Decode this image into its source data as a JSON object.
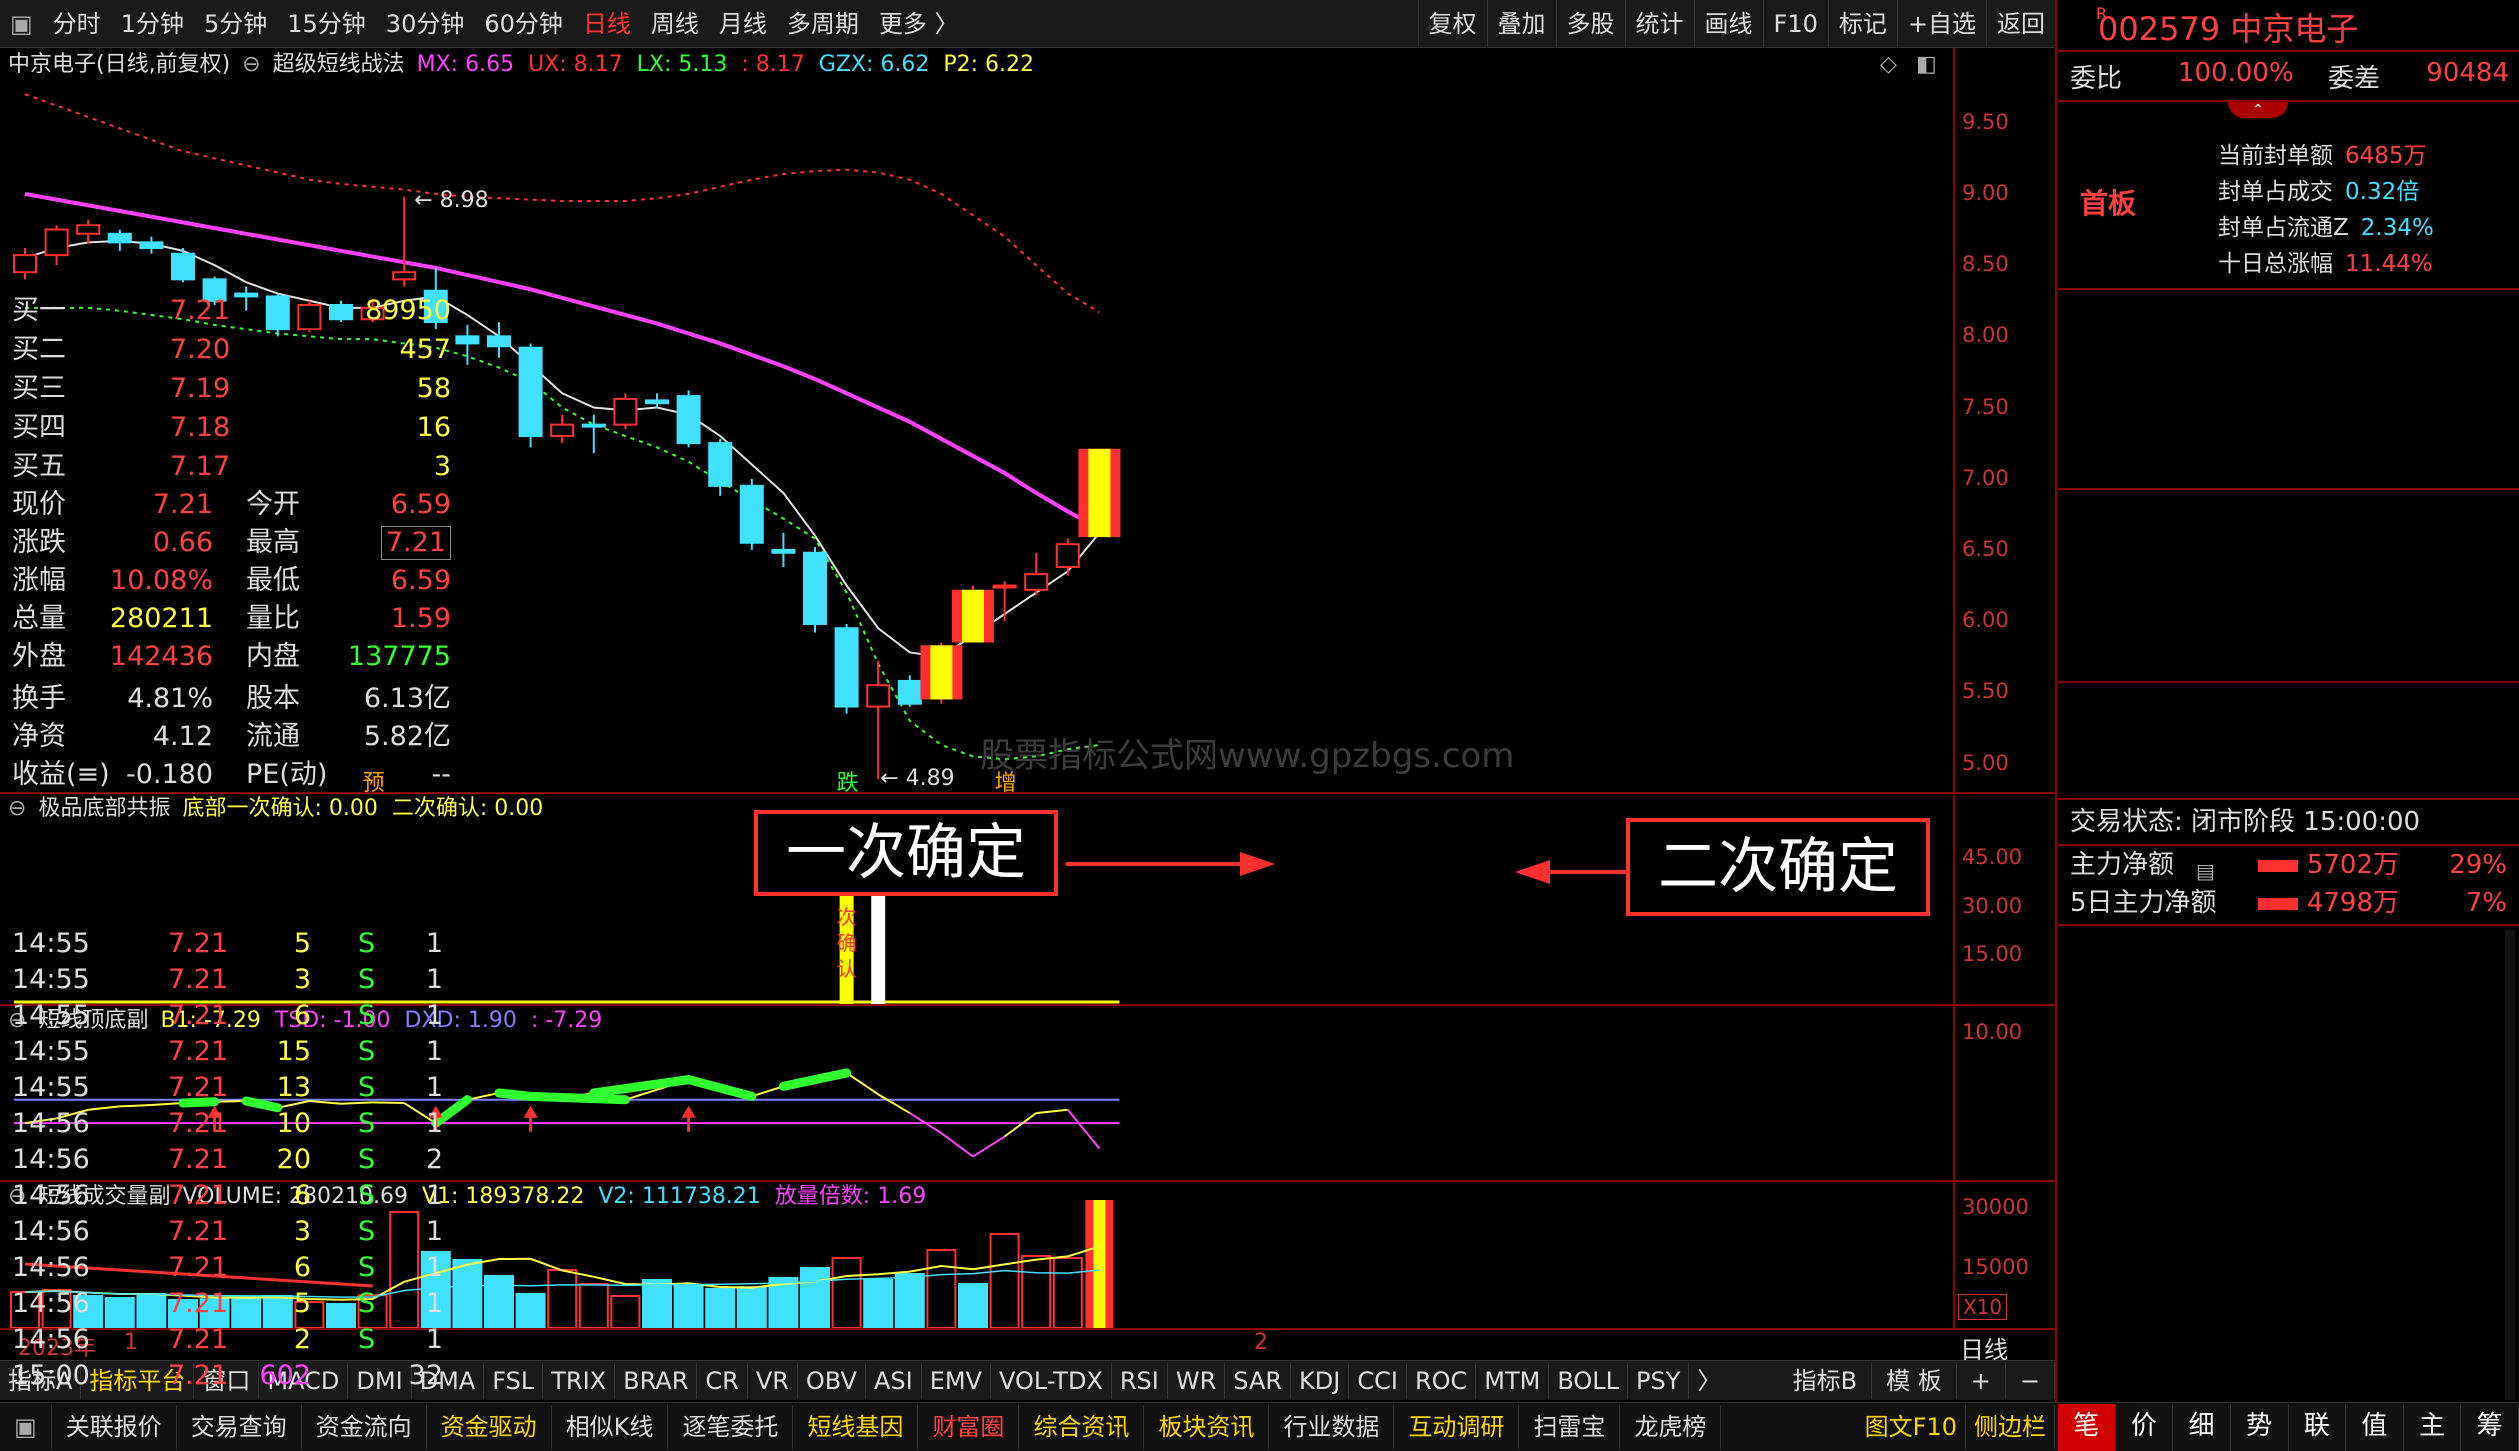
{
  "toolbar": {
    "periods": [
      "分时",
      "1分钟",
      "5分钟",
      "15分钟",
      "30分钟",
      "60分钟",
      "日线",
      "周线",
      "月线",
      "多周期",
      "更多 〉"
    ],
    "active_period": "日线",
    "right_buttons": [
      "复权",
      "叠加",
      "多股",
      "统计",
      "画线",
      "F10",
      "标记",
      "+自选",
      "返回"
    ]
  },
  "main_chart": {
    "title": "中京电子(日线,前复权)",
    "indicator": "超级短线战法",
    "params": [
      {
        "text": "MX: 6.65",
        "color": "#ff40ff"
      },
      {
        "text": "UX: 8.17",
        "color": "#ff3030"
      },
      {
        "text": "LX: 5.13",
        "color": "#30ff30"
      },
      {
        "text": ": 8.17",
        "color": "#ff3030"
      },
      {
        "text": "GZX: 6.62",
        "color": "#40e0ff"
      },
      {
        "text": "P2: 6.22",
        "color": "#ffff40"
      }
    ],
    "y_labels": [
      "9.50",
      "9.00",
      "8.50",
      "8.00",
      "7.50",
      "7.00",
      "6.50",
      "6.00",
      "5.50",
      "5.00"
    ],
    "high_marker": "8.98",
    "low_marker": "4.89",
    "tags": [
      {
        "text": "预",
        "color": "#ffa500"
      },
      {
        "text": "跌",
        "color": "#30ff30"
      },
      {
        "text": "增",
        "color": "#ffa500"
      }
    ],
    "watermark": "股票指标公式网www.gpzbgs.com"
  },
  "chart_data": [
    {
      "type": "candlestick",
      "title": "超级短线战法",
      "ylim": [
        4.8,
        9.8
      ],
      "candles": [
        {
          "o": 8.45,
          "h": 8.62,
          "l": 8.4,
          "c": 8.57
        },
        {
          "o": 8.57,
          "h": 8.78,
          "l": 8.5,
          "c": 8.75
        },
        {
          "o": 8.72,
          "h": 8.82,
          "l": 8.65,
          "c": 8.78
        },
        {
          "o": 8.72,
          "h": 8.75,
          "l": 8.6,
          "c": 8.66
        },
        {
          "o": 8.66,
          "h": 8.7,
          "l": 8.58,
          "c": 8.62
        },
        {
          "o": 8.58,
          "h": 8.62,
          "l": 8.38,
          "c": 8.4
        },
        {
          "o": 8.4,
          "h": 8.42,
          "l": 8.22,
          "c": 8.25
        },
        {
          "o": 8.3,
          "h": 8.35,
          "l": 8.18,
          "c": 8.28
        },
        {
          "o": 8.28,
          "h": 8.3,
          "l": 8.0,
          "c": 8.05
        },
        {
          "o": 8.05,
          "h": 8.25,
          "l": 8.03,
          "c": 8.22
        },
        {
          "o": 8.22,
          "h": 8.25,
          "l": 8.1,
          "c": 8.12
        },
        {
          "o": 8.12,
          "h": 8.25,
          "l": 8.1,
          "c": 8.2
        },
        {
          "o": 8.4,
          "h": 8.98,
          "l": 8.35,
          "c": 8.45
        },
        {
          "o": 8.32,
          "h": 8.48,
          "l": 8.05,
          "c": 8.1
        },
        {
          "o": 8.0,
          "h": 8.08,
          "l": 7.8,
          "c": 7.95
        },
        {
          "o": 8.0,
          "h": 8.1,
          "l": 7.85,
          "c": 7.93
        },
        {
          "o": 7.92,
          "h": 7.95,
          "l": 7.22,
          "c": 7.3
        },
        {
          "o": 7.3,
          "h": 7.45,
          "l": 7.25,
          "c": 7.38
        },
        {
          "o": 7.38,
          "h": 7.45,
          "l": 7.18,
          "c": 7.37
        },
        {
          "o": 7.38,
          "h": 7.6,
          "l": 7.35,
          "c": 7.56
        },
        {
          "o": 7.55,
          "h": 7.6,
          "l": 7.5,
          "c": 7.53
        },
        {
          "o": 7.58,
          "h": 7.62,
          "l": 7.22,
          "c": 7.25
        },
        {
          "o": 7.25,
          "h": 7.28,
          "l": 6.88,
          "c": 6.95
        },
        {
          "o": 6.95,
          "h": 7.0,
          "l": 6.5,
          "c": 6.55
        },
        {
          "o": 6.5,
          "h": 6.62,
          "l": 6.38,
          "c": 6.48
        },
        {
          "o": 6.48,
          "h": 6.52,
          "l": 5.92,
          "c": 5.98
        },
        {
          "o": 5.95,
          "h": 5.98,
          "l": 5.35,
          "c": 5.4
        },
        {
          "o": 5.4,
          "h": 5.72,
          "l": 4.89,
          "c": 5.55
        },
        {
          "o": 5.58,
          "h": 5.62,
          "l": 5.4,
          "c": 5.42
        },
        {
          "o": 5.45,
          "h": 5.85,
          "l": 5.42,
          "c": 5.83
        },
        {
          "o": 5.85,
          "h": 6.25,
          "l": 5.85,
          "c": 6.22
        },
        {
          "o": 6.25,
          "h": 6.28,
          "l": 6.0,
          "c": 6.25
        },
        {
          "o": 6.22,
          "h": 6.48,
          "l": 6.18,
          "c": 6.33
        },
        {
          "o": 6.38,
          "h": 6.58,
          "l": 6.32,
          "c": 6.54
        },
        {
          "o": 6.59,
          "h": 7.21,
          "l": 6.59,
          "c": 7.21
        }
      ],
      "series": [
        {
          "name": "MX",
          "color": "#ff40ff",
          "values": [
            9.0,
            8.96,
            8.92,
            8.88,
            8.84,
            8.8,
            8.76,
            8.72,
            8.68,
            8.64,
            8.6,
            8.56,
            8.52,
            8.48,
            8.43,
            8.38,
            8.33,
            8.27,
            8.21,
            8.15,
            8.09,
            8.02,
            7.95,
            7.87,
            7.79,
            7.7,
            7.6,
            7.5,
            7.4,
            7.28,
            7.16,
            7.04,
            6.9,
            6.77,
            6.65
          ]
        },
        {
          "name": "GZX",
          "color": "#e0e0e0",
          "values": [
            8.55,
            8.62,
            8.66,
            8.67,
            8.65,
            8.6,
            8.5,
            8.38,
            8.3,
            8.25,
            8.2,
            8.2,
            8.25,
            8.28,
            8.15,
            8.0,
            7.8,
            7.6,
            7.5,
            7.48,
            7.5,
            7.45,
            7.3,
            7.1,
            6.9,
            6.6,
            6.25,
            5.95,
            5.78,
            5.75,
            5.9,
            6.05,
            6.2,
            6.35,
            6.62
          ]
        },
        {
          "name": "LX",
          "color": "#30ff30",
          "values": [
            8.2,
            8.2,
            8.2,
            8.18,
            8.15,
            8.12,
            8.08,
            8.05,
            8.02,
            8.0,
            7.98,
            7.98,
            7.95,
            7.92,
            7.86,
            7.78,
            7.68,
            7.5,
            7.38,
            7.3,
            7.22,
            7.12,
            6.98,
            6.85,
            6.72,
            6.58,
            6.2,
            5.7,
            5.3,
            5.13,
            5.05,
            5.03,
            5.05,
            5.1,
            5.13
          ]
        },
        {
          "name": "UX",
          "color": "#ff3030",
          "values": [
            9.7,
            9.62,
            9.54,
            9.46,
            9.38,
            9.3,
            9.25,
            9.2,
            9.15,
            9.1,
            9.07,
            9.05,
            9.03,
            9.0,
            8.98,
            8.97,
            8.96,
            8.95,
            8.95,
            8.95,
            8.97,
            9.0,
            9.05,
            9.1,
            9.14,
            9.16,
            9.17,
            9.15,
            9.1,
            9.0,
            8.85,
            8.7,
            8.5,
            8.3,
            8.17
          ]
        }
      ]
    },
    {
      "type": "bar",
      "title": "极品底部共振",
      "ylim": [
        0,
        55
      ],
      "y_ticks": [
        45,
        30,
        15
      ],
      "bars": [
        {
          "index": 26,
          "value": 50,
          "color": "#ffff00",
          "label": "一次确认"
        },
        {
          "index": 27,
          "value": 50,
          "color": "#ffffff",
          "label": "二次确认"
        }
      ]
    },
    {
      "type": "line",
      "title": "短线顶底副",
      "ylim": [
        -12,
        14
      ],
      "y_ticks": [
        10
      ],
      "ref_lines": [
        {
          "value": 0,
          "color": "#8080ff"
        },
        {
          "value": -3.5,
          "color": "#ff40ff"
        }
      ],
      "values": [
        -3.5,
        -2.8,
        -1.5,
        -1.0,
        -0.8,
        -0.5,
        -0.3,
        -0.2,
        -1.2,
        -0.2,
        -0.6,
        -0.4,
        -0.5,
        -3.5,
        0.0,
        1.0,
        0.5,
        0.2,
        1.0,
        0.0,
        1.5,
        3.0,
        1.8,
        0.5,
        2.0,
        3.0,
        4.0,
        0.8,
        -2.0,
        -5.0,
        -8.5,
        -5.5,
        -2.0,
        -1.5,
        -7.29
      ],
      "highlight_ranges": [
        [
          5,
          6
        ],
        [
          7,
          8
        ],
        [
          13,
          14
        ],
        [
          15,
          16
        ],
        [
          16,
          19
        ],
        [
          18,
          21
        ],
        [
          21,
          23
        ],
        [
          24,
          26
        ]
      ],
      "arrows": [
        6,
        13,
        16,
        21
      ]
    },
    {
      "type": "bar",
      "title": "短线成交量副",
      "ylim": [
        0,
        34000
      ],
      "y_ticks": [
        30000,
        15000
      ],
      "volumes": [
        9000,
        9500,
        8000,
        7500,
        8500,
        7000,
        7200,
        7600,
        8000,
        6500,
        6000,
        8200,
        29000,
        19000,
        17000,
        13000,
        8500,
        14500,
        11000,
        8000,
        12000,
        10500,
        9800,
        10200,
        12500,
        15000,
        17500,
        12000,
        13500,
        19500,
        11000,
        23500,
        18000,
        17500,
        32000
      ],
      "up": [
        true,
        true,
        false,
        false,
        false,
        false,
        false,
        false,
        false,
        true,
        false,
        true,
        true,
        false,
        false,
        false,
        false,
        true,
        true,
        true,
        false,
        false,
        false,
        false,
        false,
        false,
        true,
        false,
        false,
        true,
        false,
        true,
        true,
        true,
        true
      ],
      "series": [
        {
          "name": "V1",
          "color": "#ffff40"
        },
        {
          "name": "V2",
          "color": "#ff3030"
        }
      ]
    }
  ],
  "sub1": {
    "title": "极品底部共振",
    "params": [
      {
        "text": "底部一次确认: 0.00",
        "color": "#ffff40"
      },
      {
        "text": "二次确认: 0.00",
        "color": "#ffff40"
      }
    ],
    "y_labels": [
      "45.00",
      "30.00",
      "15.00"
    ],
    "bar1_text": "一次确认",
    "bar2_text": "二次确认",
    "callout1": "一次确定",
    "callout2": "二次确定"
  },
  "sub2": {
    "title": "短线顶底副",
    "params": [
      {
        "text": "B1: -7.29",
        "color": "#ffff40"
      },
      {
        "text": "TSD: -1.00",
        "color": "#ff40ff"
      },
      {
        "text": "DXD: 1.90",
        "color": "#8080ff"
      },
      {
        "text": ": -7.29",
        "color": "#ff40ff"
      }
    ],
    "y_labels": [
      "10.00"
    ]
  },
  "sub3": {
    "title": "短线成交量副",
    "params": [
      {
        "text": "VOLUME: 280210.69",
        "color": "#dddddd"
      },
      {
        "text": "V1: 189378.22",
        "color": "#ffff40"
      },
      {
        "text": "V2: 111738.21",
        "color": "#40e0ff"
      },
      {
        "text": "放量倍数: 1.69",
        "color": "#ff40ff"
      }
    ],
    "y_labels": [
      "30000",
      "15000"
    ],
    "unit": "X10"
  },
  "date_axis": {
    "year": "2023年",
    "m1": "1",
    "m2": "2",
    "period": "日线"
  },
  "indicator_tabs": [
    "指标A",
    "指标平台",
    "窗口",
    "MACD",
    "DMI",
    "DMA",
    "FSL",
    "TRIX",
    "BRAR",
    "CR",
    "VR",
    "OBV",
    "ASI",
    "EMV",
    "VOL-TDX",
    "RSI",
    "WR",
    "SAR",
    "KDJ",
    "CCI",
    "ROC",
    "MTM",
    "BOLL",
    "PSY"
  ],
  "indicator_tabs_right": [
    "指标B",
    "模 板",
    "+",
    "−"
  ],
  "bottom_tabs": [
    {
      "text": "关联报价",
      "style": ""
    },
    {
      "text": "交易查询",
      "style": ""
    },
    {
      "text": "资金流向",
      "style": ""
    },
    {
      "text": "资金驱动",
      "style": "gold"
    },
    {
      "text": "相似K线",
      "style": ""
    },
    {
      "text": "逐笔委托",
      "style": ""
    },
    {
      "text": "短线基因",
      "style": "gold"
    },
    {
      "text": "财富圈",
      "style": "red"
    },
    {
      "text": "综合资讯",
      "style": "gold"
    },
    {
      "text": "板块资讯",
      "style": "gold"
    },
    {
      "text": "行业数据",
      "style": ""
    },
    {
      "text": "互动调研",
      "style": "gold"
    },
    {
      "text": "扫雷宝",
      "style": ""
    },
    {
      "text": "龙虎榜",
      "style": ""
    }
  ],
  "bottom_right_tabs": [
    "图文F10",
    "侧边栏"
  ],
  "side_tabs": [
    "笔",
    "价",
    "细",
    "势",
    "联",
    "值",
    "主",
    "筹"
  ],
  "quote": {
    "code": "002579",
    "name": "中京电子",
    "wb_label": "委比",
    "wb": "100.00%",
    "wc_label": "委差",
    "wc": "90484",
    "shouban": "首板",
    "seal_rows": [
      {
        "label": "当前封单额",
        "value": "6485万"
      },
      {
        "label": "封单占成交",
        "value": "0.32倍"
      },
      {
        "label": "封单占流通Z",
        "value": "2.34%"
      },
      {
        "label": "十日总涨幅",
        "value": "11.44%"
      }
    ],
    "bids": [
      {
        "label": "买一",
        "price": "7.21",
        "vol": "89950"
      },
      {
        "label": "买二",
        "price": "7.20",
        "vol": "457"
      },
      {
        "label": "买三",
        "price": "7.19",
        "vol": "58"
      },
      {
        "label": "买四",
        "price": "7.18",
        "vol": "16"
      },
      {
        "label": "买五",
        "price": "7.17",
        "vol": "3"
      }
    ],
    "stats": [
      {
        "l1": "现价",
        "v1": "7.21",
        "c1": "#ff4040",
        "l2": "今开",
        "v2": "6.59",
        "c2": "#ff4040"
      },
      {
        "l1": "涨跌",
        "v1": "0.66",
        "c1": "#ff4040",
        "l2": "最高",
        "v2": "7.21",
        "c2": "#ff4040"
      },
      {
        "l1": "涨幅",
        "v1": "10.08%",
        "c1": "#ff4040",
        "l2": "最低",
        "v2": "6.59",
        "c2": "#ff4040"
      },
      {
        "l1": "总量",
        "v1": "280211",
        "c1": "#ffff40",
        "l2": "量比",
        "v2": "1.59",
        "c2": "#ff4040"
      },
      {
        "l1": "外盘",
        "v1": "142436",
        "c1": "#ff4040",
        "l2": "内盘",
        "v2": "137775",
        "c2": "#30ff30"
      }
    ],
    "stats2": [
      {
        "l1": "换手",
        "v1": "4.81%",
        "l2": "股本",
        "v2": "6.13亿"
      },
      {
        "l1": "净资",
        "v1": "4.12",
        "l2": "流通",
        "v2": "5.82亿"
      },
      {
        "l1": "收益(≡)",
        "v1": "-0.180",
        "l2": "PE(动)",
        "v2": "--"
      }
    ],
    "status": "交易状态: 闭市阶段 15:00:00",
    "main_net": {
      "label": "主力净额",
      "value": "5702万",
      "pct": "29%"
    },
    "main_net5": {
      "label": "5日主力净额",
      "value": "4798万",
      "pct": "7%"
    },
    "ticks": [
      {
        "t": "14:55",
        "p": "7.21",
        "v": "5",
        "s": "S",
        "n": "1"
      },
      {
        "t": "14:55",
        "p": "7.21",
        "v": "3",
        "s": "S",
        "n": "1"
      },
      {
        "t": "14:55",
        "p": "7.21",
        "v": "6",
        "s": "S",
        "n": "1"
      },
      {
        "t": "14:55",
        "p": "7.21",
        "v": "15",
        "s": "S",
        "n": "1"
      },
      {
        "t": "14:55",
        "p": "7.21",
        "v": "13",
        "s": "S",
        "n": "1"
      },
      {
        "t": "14:56",
        "p": "7.21",
        "v": "10",
        "s": "S",
        "n": "1"
      },
      {
        "t": "14:56",
        "p": "7.21",
        "v": "20",
        "s": "S",
        "n": "2"
      },
      {
        "t": "14:56",
        "p": "7.21",
        "v": "6",
        "s": "S",
        "n": "1"
      },
      {
        "t": "14:56",
        "p": "7.21",
        "v": "3",
        "s": "S",
        "n": "1"
      },
      {
        "t": "14:56",
        "p": "7.21",
        "v": "6",
        "s": "S",
        "n": "1"
      },
      {
        "t": "14:56",
        "p": "7.21",
        "v": "5",
        "s": "S",
        "n": "1"
      },
      {
        "t": "14:56",
        "p": "7.21",
        "v": "2",
        "s": "S",
        "n": "1"
      },
      {
        "t": "15:00",
        "p": "7.21",
        "v": "602",
        "s": "",
        "n": "32"
      }
    ]
  }
}
